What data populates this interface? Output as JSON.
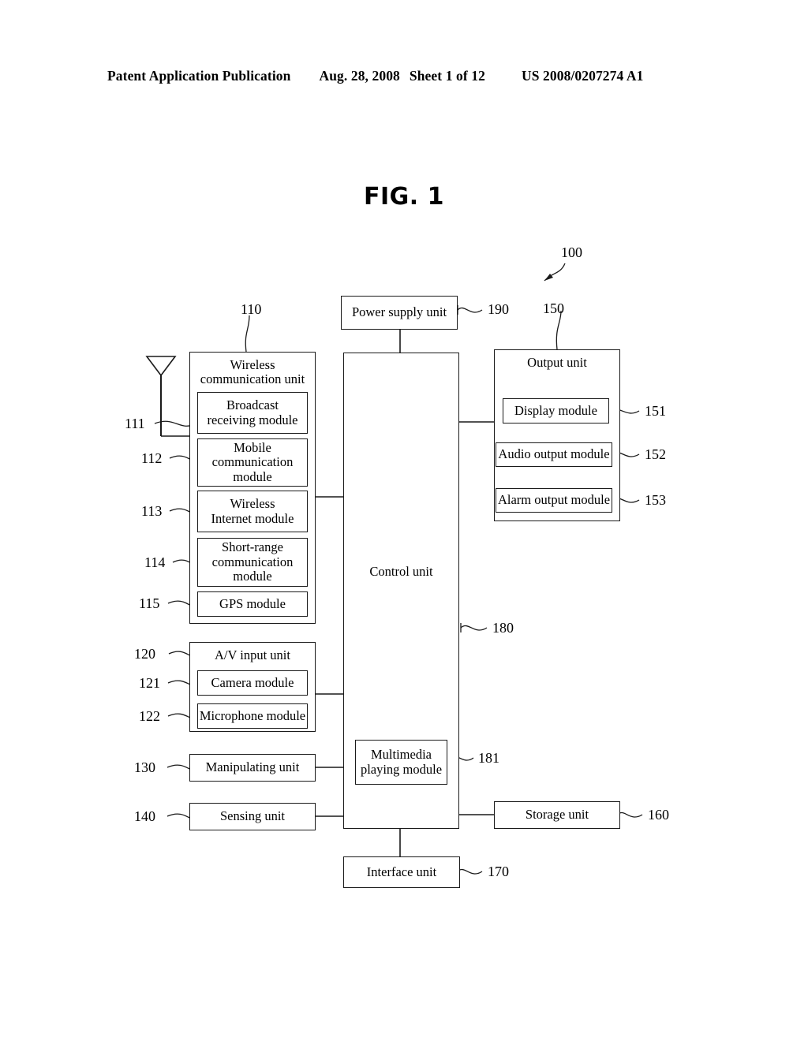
{
  "header": {
    "publication": "Patent Application Publication",
    "date": "Aug. 28, 2008",
    "sheet": "Sheet 1 of 12",
    "patent_number": "US 2008/0207274 A1"
  },
  "figure": {
    "title": "FIG. 1"
  },
  "diagram": {
    "system_ref": "100",
    "blocks": {
      "power_supply": {
        "label": "Power supply unit",
        "ref": "190"
      },
      "wireless_unit": {
        "label": "Wireless\ncommunication unit",
        "ref": "110"
      },
      "broadcast_receiving": {
        "label": "Broadcast\nreceiving module",
        "ref": "111"
      },
      "mobile_communication": {
        "label": "Mobile\ncommunication\nmodule",
        "ref": "112"
      },
      "wireless_internet": {
        "label": "Wireless\nInternet module",
        "ref": "113"
      },
      "short_range": {
        "label": "Short-range\ncommunication\nmodule",
        "ref": "114"
      },
      "gps": {
        "label": "GPS module",
        "ref": "115"
      },
      "av_input": {
        "label": "A/V input unit",
        "ref": "120"
      },
      "camera": {
        "label": "Camera module",
        "ref": "121"
      },
      "microphone": {
        "label": "Microphone module",
        "ref": "122"
      },
      "manipulating": {
        "label": "Manipulating unit",
        "ref": "130"
      },
      "sensing": {
        "label": "Sensing unit",
        "ref": "140"
      },
      "control_unit": {
        "label": "Control unit",
        "ref": "180"
      },
      "multimedia_playing": {
        "label": "Multimedia\nplaying module",
        "ref": "181"
      },
      "output_unit": {
        "label": "Output unit",
        "ref": "150"
      },
      "display_module": {
        "label": "Display module",
        "ref": "151"
      },
      "audio_output": {
        "label": "Audio output module",
        "ref": "152"
      },
      "alarm_output": {
        "label": "Alarm output module",
        "ref": "153"
      },
      "storage": {
        "label": "Storage unit",
        "ref": "160"
      },
      "interface": {
        "label": "Interface unit",
        "ref": "170"
      }
    },
    "antenna": {
      "name": "antenna-symbol"
    }
  }
}
